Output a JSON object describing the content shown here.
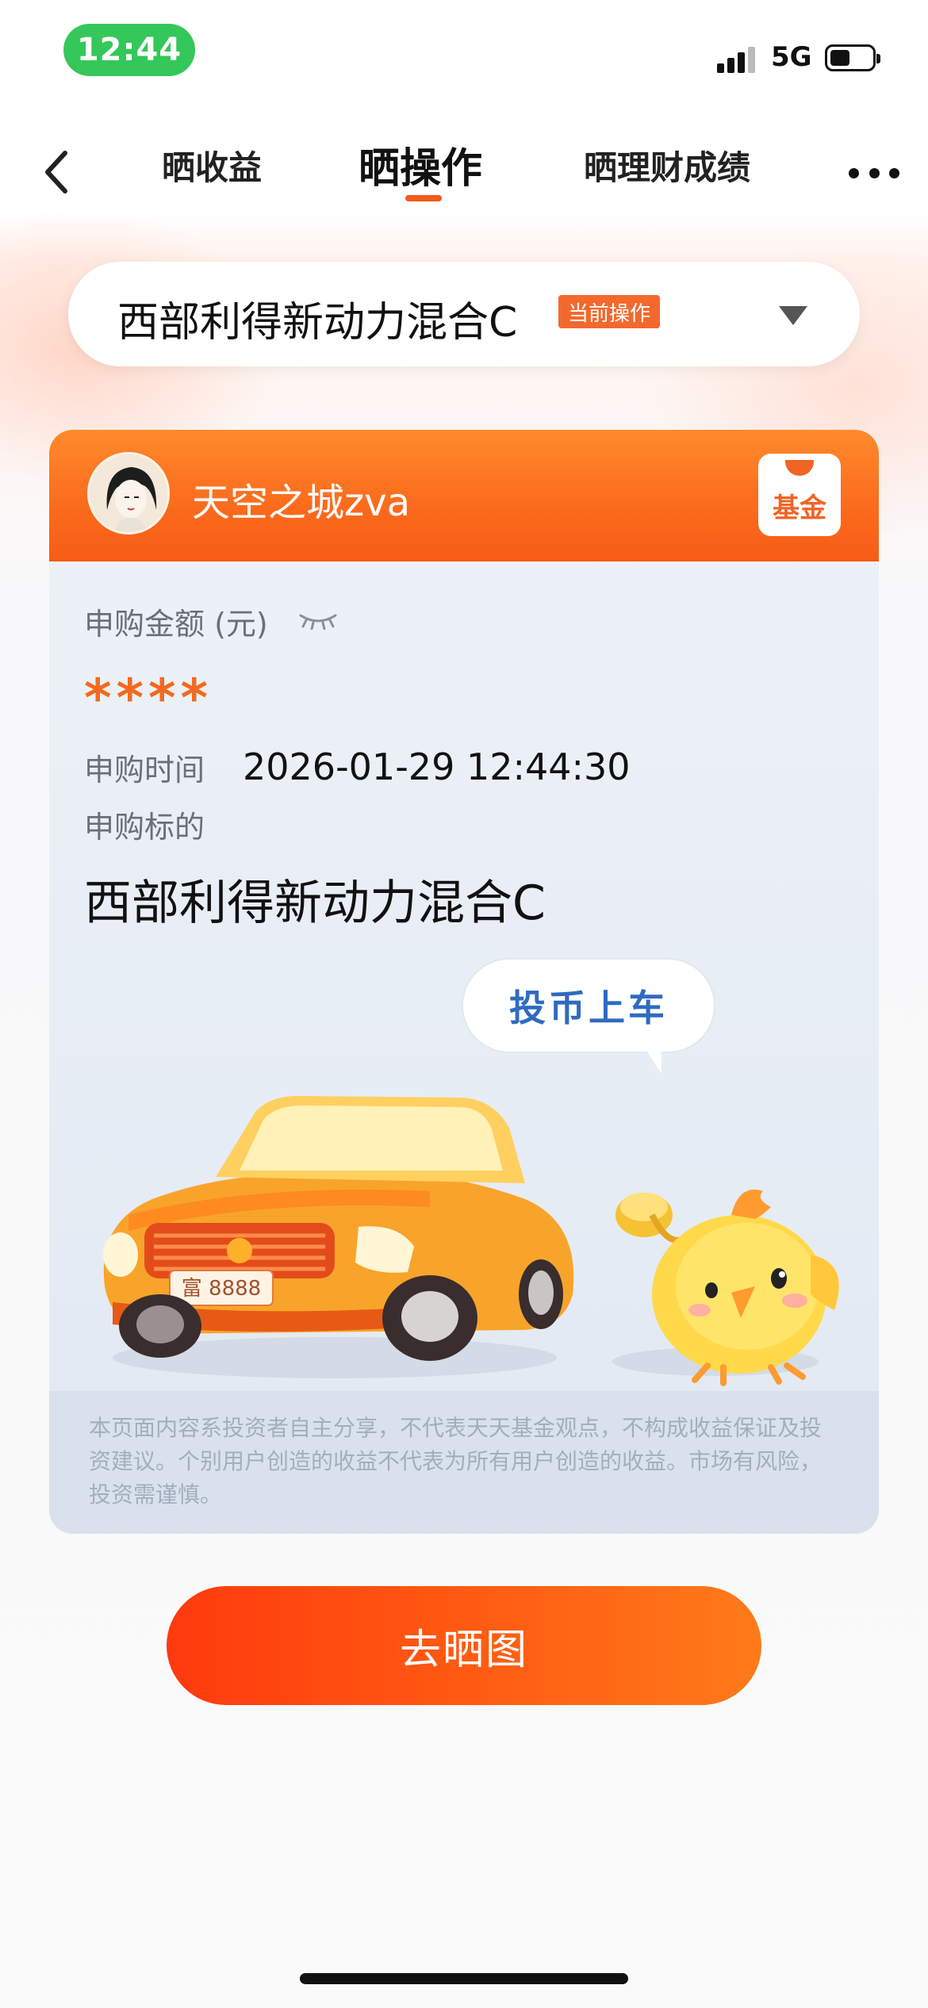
{
  "status_bar": {
    "time": "12:44",
    "network": "5G"
  },
  "nav": {
    "tabs": [
      {
        "label": "晒收益"
      },
      {
        "label": "晒操作"
      },
      {
        "label": "晒理财成绩"
      }
    ],
    "active_tab": "晒操作"
  },
  "selector": {
    "fund_name": "西部利得新动力混合C",
    "badge": "当前操作"
  },
  "card": {
    "username": "天空之城zva",
    "logo_text": "基金",
    "amount_label": "申购金额 (元)",
    "amount_value": "****",
    "time_label": "申购时间",
    "time_value": "2026-01-29 12:44:30",
    "target_label": "申购标的",
    "target_value": "西部利得新动力混合C",
    "bubble_text": "投币上车",
    "plate_text": "富 8888",
    "disclaimer": "本页面内容系投资者自主分享，不代表天天基金观点，不构成收益保证及投资建议。个别用户创造的收益不代表为所有用户创造的收益。市场有风险，投资需谨慎。"
  },
  "cta": {
    "label": "去晒图"
  },
  "colors": {
    "accent": "#f65c16",
    "status_green": "#34c759",
    "link_blue": "#2f6bc0"
  }
}
